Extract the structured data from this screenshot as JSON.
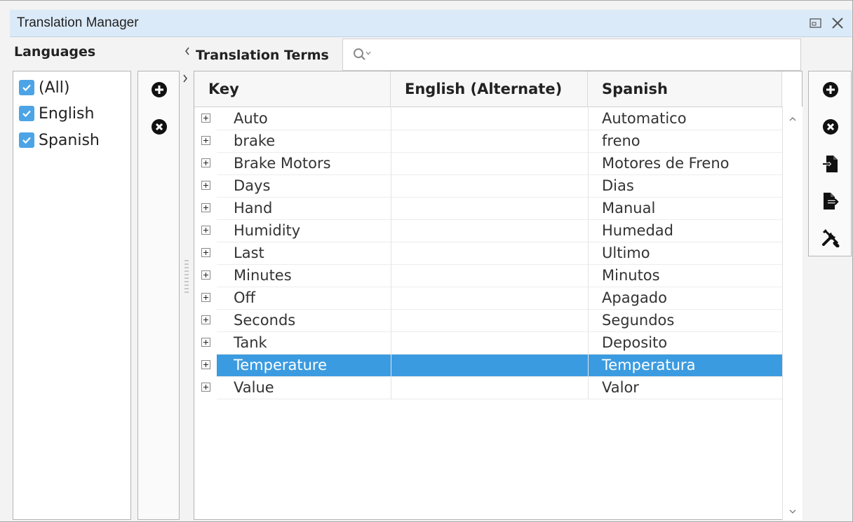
{
  "window": {
    "title": "Translation Manager"
  },
  "languages": {
    "label": "Languages",
    "items": [
      {
        "label": "(All)",
        "checked": true
      },
      {
        "label": "English",
        "checked": true
      },
      {
        "label": "Spanish",
        "checked": true
      }
    ]
  },
  "terms": {
    "label": "Translation Terms",
    "search": {
      "placeholder": "",
      "value": ""
    },
    "columns": [
      "Key",
      "English (Alternate)",
      "Spanish"
    ],
    "rows": [
      {
        "key": "Auto",
        "english_alt": "",
        "spanish": "Automatico"
      },
      {
        "key": "brake",
        "english_alt": "",
        "spanish": "freno"
      },
      {
        "key": "Brake Motors",
        "english_alt": "",
        "spanish": "Motores de Freno"
      },
      {
        "key": "Days",
        "english_alt": "",
        "spanish": "Dias"
      },
      {
        "key": "Hand",
        "english_alt": "",
        "spanish": "Manual"
      },
      {
        "key": "Humidity",
        "english_alt": "",
        "spanish": "Humedad"
      },
      {
        "key": "Last",
        "english_alt": "",
        "spanish": "Ultimo"
      },
      {
        "key": "Minutes",
        "english_alt": "",
        "spanish": "Minutos"
      },
      {
        "key": "Off",
        "english_alt": "",
        "spanish": "Apagado"
      },
      {
        "key": "Seconds",
        "english_alt": "",
        "spanish": "Segundos"
      },
      {
        "key": "Tank",
        "english_alt": "",
        "spanish": "Deposito"
      },
      {
        "key": "Temperature",
        "english_alt": "",
        "spanish": "Temperatura",
        "selected": true
      },
      {
        "key": "Value",
        "english_alt": "",
        "spanish": "Valor"
      }
    ]
  },
  "colors": {
    "selection": "#3b9be0",
    "checkbox": "#4ca4e6",
    "titlebar": "#dbeaf8"
  },
  "icons": {
    "titlebar": [
      "restore-window-icon",
      "close-icon"
    ],
    "language_actions": [
      "add-circle-icon",
      "remove-circle-icon"
    ],
    "term_actions": [
      "add-circle-icon",
      "remove-circle-icon",
      "import-icon",
      "export-icon",
      "tools-icon"
    ]
  }
}
